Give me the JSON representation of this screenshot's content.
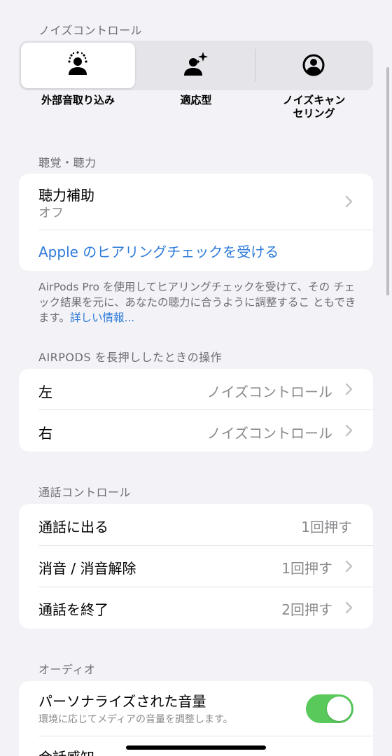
{
  "noise_control": {
    "header": "ノイズコントロール",
    "options": [
      {
        "label": "外部音取り込み",
        "icon": "transparency-icon",
        "selected": true
      },
      {
        "label": "適応型",
        "icon": "adaptive-icon",
        "selected": false
      },
      {
        "label": "ノイズキャン\nセリング",
        "icon": "noise-cancelling-icon",
        "selected": false
      }
    ]
  },
  "hearing": {
    "header": "聴覚・聴力",
    "hearing_assist_title": "聴力補助",
    "hearing_assist_value": "オフ",
    "hearing_check_link": "Apple のヒアリングチェックを受ける",
    "footnote": "AirPods Pro を使用してヒアリングチェックを受けて、その チェック結果を元に、あなたの聴力に合うように調整するこ ともできます。",
    "footnote_link": "詳しい情報..."
  },
  "press_hold": {
    "header": "AIRPODS を長押ししたときの操作",
    "rows": [
      {
        "label": "左",
        "value": "ノイズコントロール"
      },
      {
        "label": "右",
        "value": "ノイズコントロール"
      }
    ]
  },
  "call_control": {
    "header": "通話コントロール",
    "rows": [
      {
        "label": "通話に出る",
        "value": "1回押す"
      },
      {
        "label": "消音 / 消音解除",
        "value": "1回押す"
      },
      {
        "label": "通話を終了",
        "value": "2回押す"
      }
    ]
  },
  "audio": {
    "header": "オーディオ",
    "personalized_title": "パーソナライズされた音量",
    "personalized_sub": "環境に応じてメディアの音量を調整します。",
    "personalized_on": true,
    "conversation_title": "会話感知"
  },
  "colors": {
    "background": "#f2f2f7",
    "link": "#2f7bd9",
    "toggle_on": "#5ac95c"
  }
}
